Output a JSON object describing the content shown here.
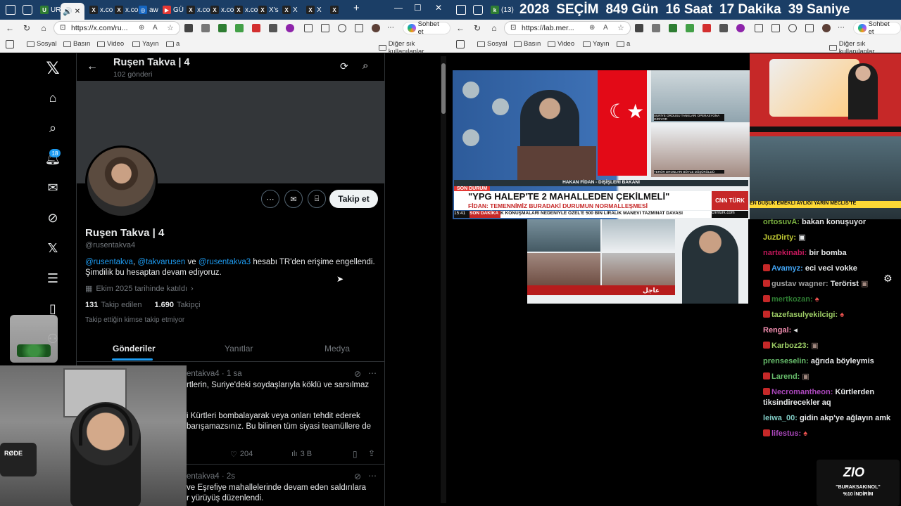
{
  "left_browser": {
    "tabs": [
      "UR",
      "x.co",
      "x.co",
      "aw",
      "GÜ",
      "x.co",
      "x.co",
      "x.co",
      "X's",
      "X",
      "X"
    ],
    "url": "https://x.com/ru...",
    "copilot_label": "Sohbet et",
    "bookmarks": [
      "Sosyal",
      "Basın",
      "Video",
      "Yayın",
      "a"
    ],
    "other_bookmarks": "Diğer sık kullanılanlar"
  },
  "right_browser": {
    "tab_label": "(13) I",
    "url": "https://lab.mer...",
    "copilot_label": "Sohbet et",
    "bookmarks": [
      "Sosyal",
      "Basın",
      "Video",
      "Yayın",
      "a"
    ],
    "other_bookmarks": "Diğer sık kullanılanlar"
  },
  "countdown": {
    "year": "2028",
    "word": "SEÇİM",
    "days": "849 Gün",
    "hours": "16 Saat",
    "minutes": "17 Dakika",
    "seconds": "39 Saniye"
  },
  "x_nav": {
    "notification_count": "18"
  },
  "profile": {
    "header_name": "Ruşen Takva | 4",
    "post_count": "102 gönderi",
    "name": "Ruşen Takva | 4",
    "handle": "@rusentakva4",
    "bio_mention1": "@rusentakva",
    "bio_comma": ",",
    "bio_mention2": "@takvarusen",
    "bio_and": "ve",
    "bio_mention3": "@rusentakva3",
    "bio_rest": "hesabı TR'den erişime engellendi.",
    "bio_line2": "Şimdilik bu hesaptan devam ediyoruz.",
    "joined": "Ekim 2025 tarihinde katıldı",
    "following_count": "131",
    "following_label": "Takip edilen",
    "followers_count": "1.690",
    "followers_label": "Takipçi",
    "no_followed": "Takip ettiğin kimse takip etmiyor",
    "follow_button": "Takip et",
    "tabs": [
      "Gönderiler",
      "Yanıtlar",
      "Medya"
    ]
  },
  "posts": [
    {
      "handle_time": "entakva4 · 1 sa",
      "line1": "rtlerin, Suriye'deki soydaşlarıyla köklü ve sarsılmaz",
      "line2": "i Kürtleri bombalayarak veya onları tehdit ederek",
      "line3": "barışamazsınız. Bu bilinen tüm siyasi teamüllere de",
      "likes": "204",
      "views": "3 B"
    },
    {
      "handle_time": "entakva4 · 2s",
      "line1": "ve Eşrefiye mahallelerinde devam eden saldırılara",
      "line2": "r yürüyüş düzenlendi."
    }
  ],
  "news": {
    "speaker": "HAKAN FİDAN - DIŞİŞLERİ BAKANI",
    "son_durum": "SON DURUM",
    "headline": "\"YPG HALEP'TE 2 MAHALLEDEN ÇEKİLMELİ\"",
    "subheadline": "FİDAN: TEMENNİMİZ BURADAKİ DURUMUN NORMALLEŞMESİ",
    "time": "15:41",
    "son_dakika": "SON DAKİKA",
    "ticker": "K KONUŞMALARI NEDENİYLE ÖZEL'E 500 BİN LİRALIK MANEVİ TAZMİNAT DAVASI",
    "channel": "CNN TÜRK",
    "site": "cnnturk.com",
    "side_caption1": "SURİYE ORDUSU TANKLARI OPERASYONA GİRİYOR",
    "side_caption2": "TERÖR DRONLARI BÖYLE DÜŞÜRÜLDÜ",
    "right_ticker": "EN DÜŞÜK EMEKLİ AYLIĞI YARIN MECLİS'TE",
    "aljazeera_label": "عاجل"
  },
  "chat": [
    {
      "user": "ortosuvA:",
      "msg": "bakan konuşuyor",
      "color": "#7cb342"
    },
    {
      "user": "JuzDirty:",
      "msg": "",
      "color": "#7cb342"
    },
    {
      "user": "nartekinabi:",
      "msg": "bir bomba",
      "color": "#c2185b"
    },
    {
      "user": "Avamyz:",
      "msg": "eci veci vokke",
      "color": "#42a5f5"
    },
    {
      "user": "gustav wagner:",
      "msg": "Terörist",
      "color": "#9e9e9e"
    },
    {
      "user": "mertkozan:",
      "msg": "",
      "color": "#2e7d32"
    },
    {
      "user": "tazefasulyekilcigi:",
      "msg": "",
      "color": "#9ccc65"
    },
    {
      "user": "Rengal:",
      "msg": "",
      "color": "#f48fb1"
    },
    {
      "user": "Karboz23:",
      "msg": "",
      "color": "#9ccc65"
    },
    {
      "user": "prenseselin:",
      "msg": "ağrıda böyleymis",
      "color": "#66bb6a"
    },
    {
      "user": "Larend:",
      "msg": "",
      "color": "#66bb6a"
    },
    {
      "user": "Necromantheon:",
      "msg": "Kürtlerden",
      "color": "#ab47bc"
    },
    {
      "user": "",
      "msg": "tiksindirecekler aq",
      "color": "#e7e9ea"
    },
    {
      "user": "leiwa_00:",
      "msg": "gidin akp'ye ağlayın amk",
      "color": "#80cbc4"
    },
    {
      "user": "lifestus:",
      "msg": "",
      "color": "#ab47bc"
    }
  ],
  "sponsor": {
    "logo": "ZIO",
    "code": "\"BURAKSAKINOL\"",
    "discount": "%10 İNDİRİM"
  },
  "webcam_mic_label": "RØDE"
}
